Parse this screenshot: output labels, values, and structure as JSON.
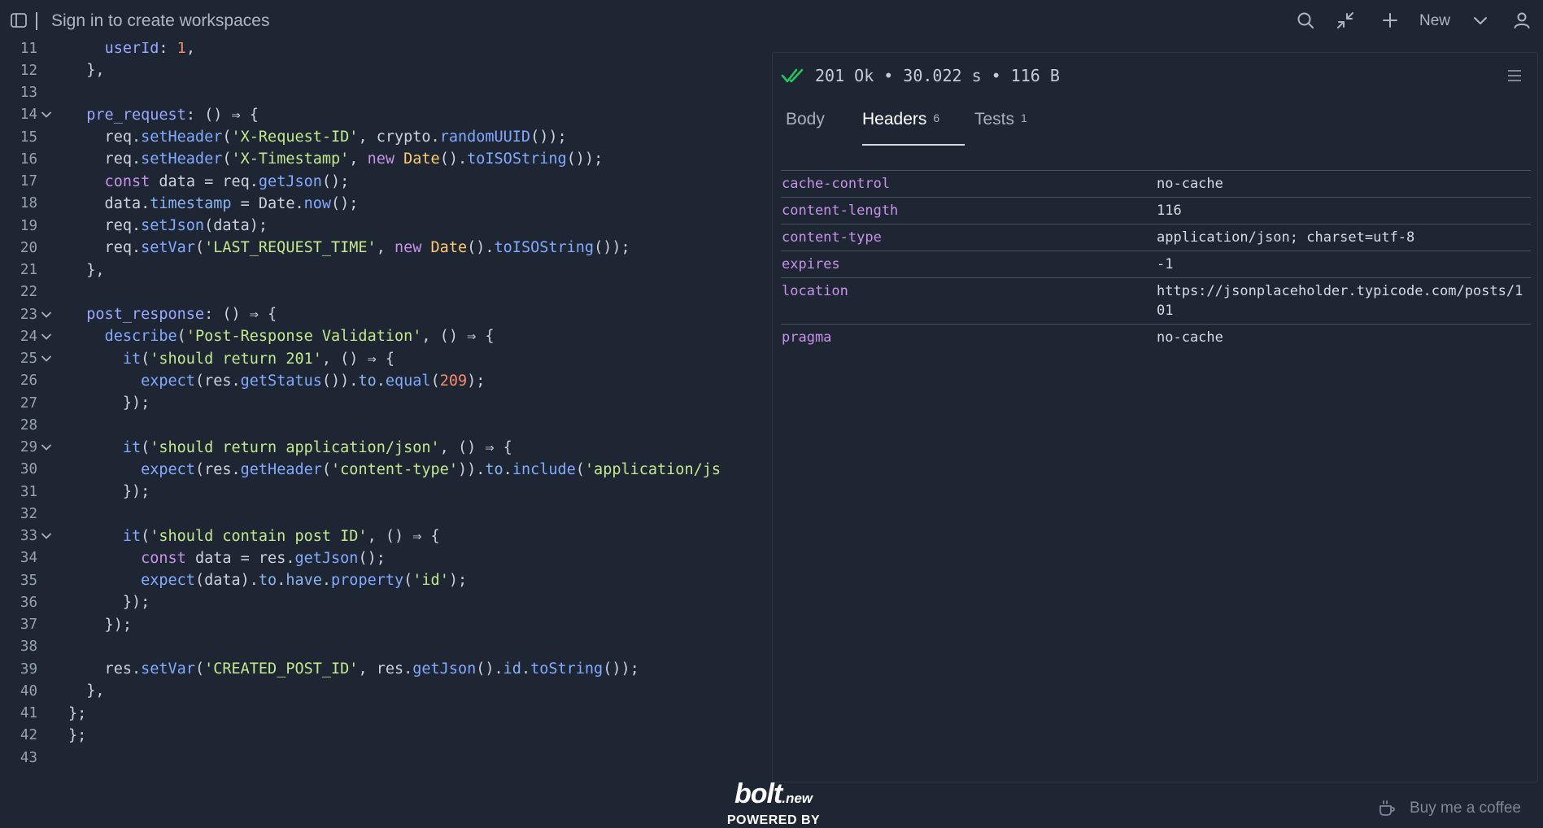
{
  "topbar": {
    "workspace_text": "Sign in to create workspaces",
    "new_label": "New",
    "icons": [
      "sidebar-toggle-icon",
      "search-icon",
      "minimize-icon",
      "plus-icon",
      "chevron-down-icon",
      "user-icon"
    ]
  },
  "editor": {
    "lines": [
      {
        "n": "11",
        "fold": false
      },
      {
        "n": "12",
        "fold": false
      },
      {
        "n": "13",
        "fold": false
      },
      {
        "n": "14",
        "fold": true
      },
      {
        "n": "15",
        "fold": false
      },
      {
        "n": "16",
        "fold": false
      },
      {
        "n": "17",
        "fold": false
      },
      {
        "n": "18",
        "fold": false
      },
      {
        "n": "19",
        "fold": false
      },
      {
        "n": "20",
        "fold": false
      },
      {
        "n": "21",
        "fold": false
      },
      {
        "n": "22",
        "fold": false
      },
      {
        "n": "23",
        "fold": true
      },
      {
        "n": "24",
        "fold": true
      },
      {
        "n": "25",
        "fold": true
      },
      {
        "n": "26",
        "fold": false
      },
      {
        "n": "27",
        "fold": false
      },
      {
        "n": "28",
        "fold": false
      },
      {
        "n": "29",
        "fold": true
      },
      {
        "n": "30",
        "fold": false
      },
      {
        "n": "31",
        "fold": false
      },
      {
        "n": "32",
        "fold": false
      },
      {
        "n": "33",
        "fold": true
      },
      {
        "n": "34",
        "fold": false
      },
      {
        "n": "35",
        "fold": false
      },
      {
        "n": "36",
        "fold": false
      },
      {
        "n": "37",
        "fold": false
      },
      {
        "n": "38",
        "fold": false
      },
      {
        "n": "39",
        "fold": false
      },
      {
        "n": "40",
        "fold": false
      },
      {
        "n": "41",
        "fold": false
      },
      {
        "n": "42",
        "fold": false
      },
      {
        "n": "43",
        "fold": false
      }
    ],
    "code": [
      [
        [
          "    ",
          ""
        ],
        [
          "userId",
          "key"
        ],
        [
          ": ",
          ""
        ],
        [
          "1",
          "num"
        ],
        [
          ",",
          ""
        ]
      ],
      [
        [
          "  },",
          ""
        ]
      ],
      [
        [
          "",
          ""
        ]
      ],
      [
        [
          "  ",
          ""
        ],
        [
          "pre_request",
          "key"
        ],
        [
          ": () ⇒ {",
          ""
        ]
      ],
      [
        [
          "    req.",
          ""
        ],
        [
          "setHeader",
          "fn"
        ],
        [
          "(",
          ""
        ],
        [
          "'X-Request-ID'",
          "str"
        ],
        [
          ", crypto.",
          ""
        ],
        [
          "randomUUID",
          "fn"
        ],
        [
          "());",
          ""
        ]
      ],
      [
        [
          "    req.",
          ""
        ],
        [
          "setHeader",
          "fn"
        ],
        [
          "(",
          ""
        ],
        [
          "'X-Timestamp'",
          "str"
        ],
        [
          ", ",
          ""
        ],
        [
          "new",
          "kw"
        ],
        [
          " ",
          ""
        ],
        [
          "Date",
          "cls"
        ],
        [
          "().",
          ""
        ],
        [
          "toISOString",
          "fn"
        ],
        [
          "());",
          ""
        ]
      ],
      [
        [
          "    ",
          ""
        ],
        [
          "const",
          "kw"
        ],
        [
          " data = req.",
          ""
        ],
        [
          "getJson",
          "fn"
        ],
        [
          "();",
          ""
        ]
      ],
      [
        [
          "    data.",
          ""
        ],
        [
          "timestamp",
          "prop"
        ],
        [
          " = Date.",
          ""
        ],
        [
          "now",
          "fn"
        ],
        [
          "();",
          ""
        ]
      ],
      [
        [
          "    req.",
          ""
        ],
        [
          "setJson",
          "fn"
        ],
        [
          "(data);",
          ""
        ]
      ],
      [
        [
          "    req.",
          ""
        ],
        [
          "setVar",
          "fn"
        ],
        [
          "(",
          ""
        ],
        [
          "'LAST_REQUEST_TIME'",
          "str"
        ],
        [
          ", ",
          ""
        ],
        [
          "new",
          "kw"
        ],
        [
          " ",
          ""
        ],
        [
          "Date",
          "cls"
        ],
        [
          "().",
          ""
        ],
        [
          "toISOString",
          "fn"
        ],
        [
          "());",
          ""
        ]
      ],
      [
        [
          "  },",
          ""
        ]
      ],
      [
        [
          "",
          ""
        ]
      ],
      [
        [
          "  ",
          ""
        ],
        [
          "post_response",
          "key"
        ],
        [
          ": () ⇒ {",
          ""
        ]
      ],
      [
        [
          "    ",
          ""
        ],
        [
          "describe",
          "fn"
        ],
        [
          "(",
          ""
        ],
        [
          "'Post-Response Validation'",
          "str"
        ],
        [
          ", () ⇒ {",
          ""
        ]
      ],
      [
        [
          "      ",
          ""
        ],
        [
          "it",
          "fn"
        ],
        [
          "(",
          ""
        ],
        [
          "'should return 201'",
          "str"
        ],
        [
          ", () ⇒ {",
          ""
        ]
      ],
      [
        [
          "        ",
          ""
        ],
        [
          "expect",
          "fn"
        ],
        [
          "(res.",
          ""
        ],
        [
          "getStatus",
          "fn"
        ],
        [
          "()).",
          ""
        ],
        [
          "to",
          "prop"
        ],
        [
          ".",
          ""
        ],
        [
          "equal",
          "fn"
        ],
        [
          "(",
          ""
        ],
        [
          "209",
          "num"
        ],
        [
          ");",
          ""
        ]
      ],
      [
        [
          "      });",
          ""
        ]
      ],
      [
        [
          "",
          ""
        ]
      ],
      [
        [
          "      ",
          ""
        ],
        [
          "it",
          "fn"
        ],
        [
          "(",
          ""
        ],
        [
          "'should return application/json'",
          "str"
        ],
        [
          ", () ⇒ {",
          ""
        ]
      ],
      [
        [
          "        ",
          ""
        ],
        [
          "expect",
          "fn"
        ],
        [
          "(res.",
          ""
        ],
        [
          "getHeader",
          "fn"
        ],
        [
          "(",
          ""
        ],
        [
          "'content-type'",
          "str"
        ],
        [
          ")).",
          ""
        ],
        [
          "to",
          "prop"
        ],
        [
          ".",
          ""
        ],
        [
          "include",
          "fn"
        ],
        [
          "(",
          ""
        ],
        [
          "'application/js",
          "str"
        ]
      ],
      [
        [
          "      });",
          ""
        ]
      ],
      [
        [
          "",
          ""
        ]
      ],
      [
        [
          "      ",
          ""
        ],
        [
          "it",
          "fn"
        ],
        [
          "(",
          ""
        ],
        [
          "'should contain post ID'",
          "str"
        ],
        [
          ", () ⇒ {",
          ""
        ]
      ],
      [
        [
          "        ",
          ""
        ],
        [
          "const",
          "kw"
        ],
        [
          " data = res.",
          ""
        ],
        [
          "getJson",
          "fn"
        ],
        [
          "();",
          ""
        ]
      ],
      [
        [
          "        ",
          ""
        ],
        [
          "expect",
          "fn"
        ],
        [
          "(data).",
          ""
        ],
        [
          "to",
          "prop"
        ],
        [
          ".",
          ""
        ],
        [
          "have",
          "prop"
        ],
        [
          ".",
          ""
        ],
        [
          "property",
          "fn"
        ],
        [
          "(",
          ""
        ],
        [
          "'id'",
          "str"
        ],
        [
          ");",
          ""
        ]
      ],
      [
        [
          "      });",
          ""
        ]
      ],
      [
        [
          "    });",
          ""
        ]
      ],
      [
        [
          "",
          ""
        ]
      ],
      [
        [
          "    res.",
          ""
        ],
        [
          "setVar",
          "fn"
        ],
        [
          "(",
          ""
        ],
        [
          "'CREATED_POST_ID'",
          "str"
        ],
        [
          ", res.",
          ""
        ],
        [
          "getJson",
          "fn"
        ],
        [
          "().",
          ""
        ],
        [
          "id",
          "prop"
        ],
        [
          ".",
          ""
        ],
        [
          "toString",
          "fn"
        ],
        [
          "());",
          ""
        ]
      ],
      [
        [
          "  },",
          ""
        ]
      ],
      [
        [
          "};",
          ""
        ]
      ],
      [
        [
          "};",
          ""
        ]
      ],
      [
        [
          "",
          ""
        ]
      ]
    ]
  },
  "response": {
    "status": "201 Ok",
    "time": "30.022 s",
    "size": "116 B",
    "separator": "•",
    "tabs": [
      {
        "label": "Body",
        "count": ""
      },
      {
        "label": "Headers",
        "count": "6"
      },
      {
        "label": "Tests",
        "count": "1"
      }
    ],
    "active_tab": "Headers",
    "headers": [
      {
        "key": "cache-control",
        "value": "no-cache"
      },
      {
        "key": "content-length",
        "value": "116"
      },
      {
        "key": "content-type",
        "value": "application/json; charset=utf-8"
      },
      {
        "key": "expires",
        "value": "-1"
      },
      {
        "key": "location",
        "value": "https://jsonplaceholder.typicode.com/posts/101"
      },
      {
        "key": "pragma",
        "value": "no-cache"
      }
    ]
  },
  "footer": {
    "bolt_word": "bolt",
    "bolt_suffix": ".new",
    "powered_by": "POWERED BY",
    "coffee_label": "Buy me a coffee"
  },
  "colors": {
    "background": "#1e2633",
    "string": "#c3e88d",
    "function": "#82aaff",
    "keyword": "#c792ea",
    "header_key": "#c792ea",
    "success": "#22c55e"
  }
}
